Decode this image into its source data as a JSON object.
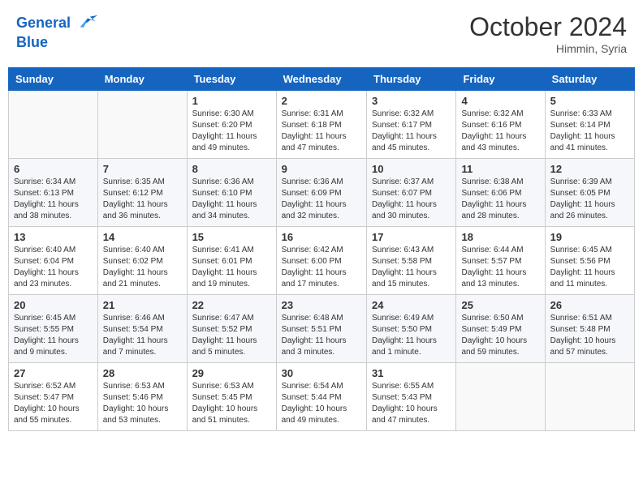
{
  "header": {
    "logo_line1": "General",
    "logo_line2": "Blue",
    "month_title": "October 2024",
    "location": "Himmin, Syria"
  },
  "days_of_week": [
    "Sunday",
    "Monday",
    "Tuesday",
    "Wednesday",
    "Thursday",
    "Friday",
    "Saturday"
  ],
  "weeks": [
    [
      {
        "day": "",
        "info": ""
      },
      {
        "day": "",
        "info": ""
      },
      {
        "day": "1",
        "info": "Sunrise: 6:30 AM\nSunset: 6:20 PM\nDaylight: 11 hours and 49 minutes."
      },
      {
        "day": "2",
        "info": "Sunrise: 6:31 AM\nSunset: 6:18 PM\nDaylight: 11 hours and 47 minutes."
      },
      {
        "day": "3",
        "info": "Sunrise: 6:32 AM\nSunset: 6:17 PM\nDaylight: 11 hours and 45 minutes."
      },
      {
        "day": "4",
        "info": "Sunrise: 6:32 AM\nSunset: 6:16 PM\nDaylight: 11 hours and 43 minutes."
      },
      {
        "day": "5",
        "info": "Sunrise: 6:33 AM\nSunset: 6:14 PM\nDaylight: 11 hours and 41 minutes."
      }
    ],
    [
      {
        "day": "6",
        "info": "Sunrise: 6:34 AM\nSunset: 6:13 PM\nDaylight: 11 hours and 38 minutes."
      },
      {
        "day": "7",
        "info": "Sunrise: 6:35 AM\nSunset: 6:12 PM\nDaylight: 11 hours and 36 minutes."
      },
      {
        "day": "8",
        "info": "Sunrise: 6:36 AM\nSunset: 6:10 PM\nDaylight: 11 hours and 34 minutes."
      },
      {
        "day": "9",
        "info": "Sunrise: 6:36 AM\nSunset: 6:09 PM\nDaylight: 11 hours and 32 minutes."
      },
      {
        "day": "10",
        "info": "Sunrise: 6:37 AM\nSunset: 6:07 PM\nDaylight: 11 hours and 30 minutes."
      },
      {
        "day": "11",
        "info": "Sunrise: 6:38 AM\nSunset: 6:06 PM\nDaylight: 11 hours and 28 minutes."
      },
      {
        "day": "12",
        "info": "Sunrise: 6:39 AM\nSunset: 6:05 PM\nDaylight: 11 hours and 26 minutes."
      }
    ],
    [
      {
        "day": "13",
        "info": "Sunrise: 6:40 AM\nSunset: 6:04 PM\nDaylight: 11 hours and 23 minutes."
      },
      {
        "day": "14",
        "info": "Sunrise: 6:40 AM\nSunset: 6:02 PM\nDaylight: 11 hours and 21 minutes."
      },
      {
        "day": "15",
        "info": "Sunrise: 6:41 AM\nSunset: 6:01 PM\nDaylight: 11 hours and 19 minutes."
      },
      {
        "day": "16",
        "info": "Sunrise: 6:42 AM\nSunset: 6:00 PM\nDaylight: 11 hours and 17 minutes."
      },
      {
        "day": "17",
        "info": "Sunrise: 6:43 AM\nSunset: 5:58 PM\nDaylight: 11 hours and 15 minutes."
      },
      {
        "day": "18",
        "info": "Sunrise: 6:44 AM\nSunset: 5:57 PM\nDaylight: 11 hours and 13 minutes."
      },
      {
        "day": "19",
        "info": "Sunrise: 6:45 AM\nSunset: 5:56 PM\nDaylight: 11 hours and 11 minutes."
      }
    ],
    [
      {
        "day": "20",
        "info": "Sunrise: 6:45 AM\nSunset: 5:55 PM\nDaylight: 11 hours and 9 minutes."
      },
      {
        "day": "21",
        "info": "Sunrise: 6:46 AM\nSunset: 5:54 PM\nDaylight: 11 hours and 7 minutes."
      },
      {
        "day": "22",
        "info": "Sunrise: 6:47 AM\nSunset: 5:52 PM\nDaylight: 11 hours and 5 minutes."
      },
      {
        "day": "23",
        "info": "Sunrise: 6:48 AM\nSunset: 5:51 PM\nDaylight: 11 hours and 3 minutes."
      },
      {
        "day": "24",
        "info": "Sunrise: 6:49 AM\nSunset: 5:50 PM\nDaylight: 11 hours and 1 minute."
      },
      {
        "day": "25",
        "info": "Sunrise: 6:50 AM\nSunset: 5:49 PM\nDaylight: 10 hours and 59 minutes."
      },
      {
        "day": "26",
        "info": "Sunrise: 6:51 AM\nSunset: 5:48 PM\nDaylight: 10 hours and 57 minutes."
      }
    ],
    [
      {
        "day": "27",
        "info": "Sunrise: 6:52 AM\nSunset: 5:47 PM\nDaylight: 10 hours and 55 minutes."
      },
      {
        "day": "28",
        "info": "Sunrise: 6:53 AM\nSunset: 5:46 PM\nDaylight: 10 hours and 53 minutes."
      },
      {
        "day": "29",
        "info": "Sunrise: 6:53 AM\nSunset: 5:45 PM\nDaylight: 10 hours and 51 minutes."
      },
      {
        "day": "30",
        "info": "Sunrise: 6:54 AM\nSunset: 5:44 PM\nDaylight: 10 hours and 49 minutes."
      },
      {
        "day": "31",
        "info": "Sunrise: 6:55 AM\nSunset: 5:43 PM\nDaylight: 10 hours and 47 minutes."
      },
      {
        "day": "",
        "info": ""
      },
      {
        "day": "",
        "info": ""
      }
    ]
  ]
}
